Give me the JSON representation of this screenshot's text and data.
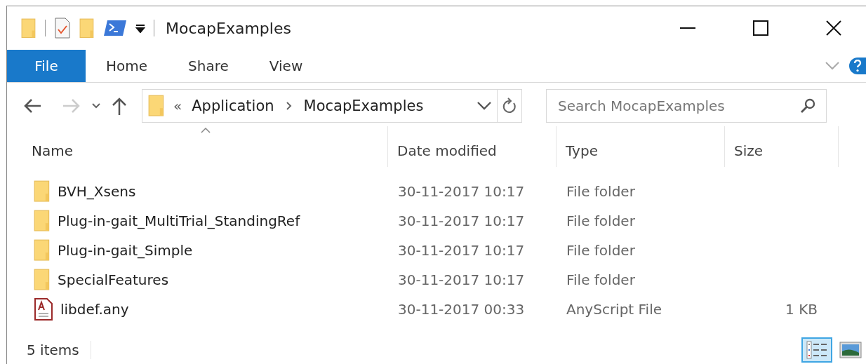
{
  "window": {
    "title": "MocapExamples"
  },
  "ribbon_tabs": [
    {
      "label": "File",
      "selected": true
    },
    {
      "label": "Home",
      "selected": false
    },
    {
      "label": "Share",
      "selected": false
    },
    {
      "label": "View",
      "selected": false
    }
  ],
  "address_bar": {
    "overflow_marker": "«",
    "breadcrumbs": [
      "Application",
      "MocapExamples"
    ]
  },
  "search": {
    "placeholder": "Search MocapExamples"
  },
  "columns": [
    {
      "label": "Name",
      "sorted": true
    },
    {
      "label": "Date modified",
      "sorted": false
    },
    {
      "label": "Type",
      "sorted": false
    },
    {
      "label": "Size",
      "sorted": false
    }
  ],
  "rows": [
    {
      "kind": "folder",
      "name": "BVH_Xsens",
      "date": "30-11-2017 10:17",
      "type": "File folder"
    },
    {
      "kind": "folder",
      "name": "Plug-in-gait_MultiTrial_StandingRef",
      "date": "30-11-2017 10:17",
      "type": "File folder"
    },
    {
      "kind": "folder",
      "name": "Plug-in-gait_Simple",
      "date": "30-11-2017 10:17",
      "type": "File folder"
    },
    {
      "kind": "folder",
      "name": "SpecialFeatures",
      "date": "30-11-2017 10:17",
      "type": "File folder"
    },
    {
      "kind": "file",
      "name": "libdef.any",
      "date": "30-11-2017 00:33",
      "type": "AnyScript File",
      "size": "1 KB"
    }
  ],
  "status_bar": {
    "item_count": "5 items",
    "views": [
      {
        "kind": "details",
        "selected": true
      },
      {
        "kind": "thumbnails",
        "selected": false
      }
    ]
  }
}
